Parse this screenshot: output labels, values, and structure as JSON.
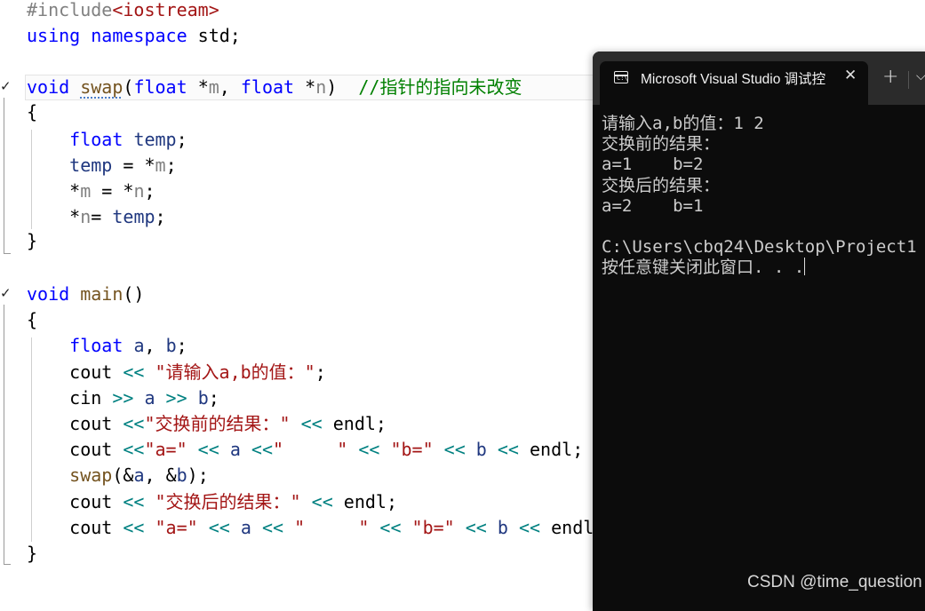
{
  "editor": {
    "lines": [
      {
        "id": "l1",
        "tokens": [
          {
            "t": "#include",
            "c": "#808080"
          },
          {
            "t": "<iostream>",
            "c": "#a31515"
          }
        ]
      },
      {
        "id": "l2",
        "tokens": [
          {
            "t": "using",
            "c": "#0000ff"
          },
          {
            "t": " ",
            "c": "#000"
          },
          {
            "t": "namespace",
            "c": "#0000ff"
          },
          {
            "t": " std;",
            "c": "#000000"
          }
        ]
      },
      {
        "id": "l3",
        "tokens": [
          {
            "t": "void",
            "c": "#0000ff"
          },
          {
            "t": " ",
            "c": "#000"
          },
          {
            "t": "swap",
            "c": "#74531f",
            "u": true
          },
          {
            "t": "(",
            "c": "#000"
          },
          {
            "t": "float",
            "c": "#0000ff"
          },
          {
            "t": " *",
            "c": "#000"
          },
          {
            "t": "m",
            "c": "#808080"
          },
          {
            "t": ", ",
            "c": "#000"
          },
          {
            "t": "float",
            "c": "#0000ff"
          },
          {
            "t": " *",
            "c": "#000"
          },
          {
            "t": "n",
            "c": "#808080"
          },
          {
            "t": ")  ",
            "c": "#000"
          },
          {
            "t": "//指针的指向未改变",
            "c": "#008000"
          }
        ]
      },
      {
        "id": "l4",
        "tokens": [
          {
            "t": "{",
            "c": "#000"
          }
        ]
      },
      {
        "id": "l5",
        "tokens": [
          {
            "t": "    ",
            "c": "#000"
          },
          {
            "t": "float",
            "c": "#0000ff"
          },
          {
            "t": " ",
            "c": "#000"
          },
          {
            "t": "temp",
            "c": "#1f377f"
          },
          {
            "t": ";",
            "c": "#000"
          }
        ]
      },
      {
        "id": "l6",
        "tokens": [
          {
            "t": "    ",
            "c": "#000"
          },
          {
            "t": "temp",
            "c": "#1f377f"
          },
          {
            "t": " = *",
            "c": "#000"
          },
          {
            "t": "m",
            "c": "#808080"
          },
          {
            "t": ";",
            "c": "#000"
          }
        ]
      },
      {
        "id": "l7",
        "tokens": [
          {
            "t": "    *",
            "c": "#000"
          },
          {
            "t": "m",
            "c": "#808080"
          },
          {
            "t": " = *",
            "c": "#000"
          },
          {
            "t": "n",
            "c": "#808080"
          },
          {
            "t": ";",
            "c": "#000"
          }
        ]
      },
      {
        "id": "l8",
        "tokens": [
          {
            "t": "    *",
            "c": "#000"
          },
          {
            "t": "n",
            "c": "#808080"
          },
          {
            "t": "= ",
            "c": "#000"
          },
          {
            "t": "temp",
            "c": "#1f377f"
          },
          {
            "t": ";",
            "c": "#000"
          }
        ]
      },
      {
        "id": "l9",
        "tokens": [
          {
            "t": "}",
            "c": "#000"
          }
        ]
      },
      {
        "id": "l10",
        "tokens": []
      },
      {
        "id": "l11",
        "tokens": [
          {
            "t": "void",
            "c": "#0000ff"
          },
          {
            "t": " ",
            "c": "#000"
          },
          {
            "t": "main",
            "c": "#74531f"
          },
          {
            "t": "()",
            "c": "#000"
          }
        ]
      },
      {
        "id": "l12",
        "tokens": [
          {
            "t": "{",
            "c": "#000"
          }
        ]
      },
      {
        "id": "l13",
        "tokens": [
          {
            "t": "    ",
            "c": "#000"
          },
          {
            "t": "float",
            "c": "#0000ff"
          },
          {
            "t": " ",
            "c": "#000"
          },
          {
            "t": "a",
            "c": "#1f377f"
          },
          {
            "t": ", ",
            "c": "#000"
          },
          {
            "t": "b",
            "c": "#1f377f"
          },
          {
            "t": ";",
            "c": "#000"
          }
        ]
      },
      {
        "id": "l14",
        "tokens": [
          {
            "t": "    ",
            "c": "#000"
          },
          {
            "t": "cout",
            "c": "#000"
          },
          {
            "t": " << ",
            "c": "#008080"
          },
          {
            "t": "\"请输入a,b的值：\"",
            "c": "#a31515"
          },
          {
            "t": ";",
            "c": "#000"
          }
        ]
      },
      {
        "id": "l15",
        "tokens": [
          {
            "t": "    ",
            "c": "#000"
          },
          {
            "t": "cin",
            "c": "#000"
          },
          {
            "t": " >> ",
            "c": "#008080"
          },
          {
            "t": "a",
            "c": "#1f377f"
          },
          {
            "t": " >> ",
            "c": "#008080"
          },
          {
            "t": "b",
            "c": "#1f377f"
          },
          {
            "t": ";",
            "c": "#000"
          }
        ]
      },
      {
        "id": "l16",
        "tokens": [
          {
            "t": "    ",
            "c": "#000"
          },
          {
            "t": "cout",
            "c": "#000"
          },
          {
            "t": " <<",
            "c": "#008080"
          },
          {
            "t": "\"交换前的结果：\"",
            "c": "#a31515"
          },
          {
            "t": " << ",
            "c": "#008080"
          },
          {
            "t": "endl",
            "c": "#000"
          },
          {
            "t": ";",
            "c": "#000"
          }
        ]
      },
      {
        "id": "l17",
        "tokens": [
          {
            "t": "    ",
            "c": "#000"
          },
          {
            "t": "cout",
            "c": "#000"
          },
          {
            "t": " <<",
            "c": "#008080"
          },
          {
            "t": "\"a=\"",
            "c": "#a31515"
          },
          {
            "t": " << ",
            "c": "#008080"
          },
          {
            "t": "a",
            "c": "#1f377f"
          },
          {
            "t": " <<",
            "c": "#008080"
          },
          {
            "t": "\"     \"",
            "c": "#a31515"
          },
          {
            "t": " << ",
            "c": "#008080"
          },
          {
            "t": "\"b=\"",
            "c": "#a31515"
          },
          {
            "t": " << ",
            "c": "#008080"
          },
          {
            "t": "b",
            "c": "#1f377f"
          },
          {
            "t": " << ",
            "c": "#008080"
          },
          {
            "t": "endl",
            "c": "#000"
          },
          {
            "t": ";",
            "c": "#000"
          }
        ]
      },
      {
        "id": "l18",
        "tokens": [
          {
            "t": "    ",
            "c": "#000"
          },
          {
            "t": "swap",
            "c": "#74531f"
          },
          {
            "t": "(&",
            "c": "#000"
          },
          {
            "t": "a",
            "c": "#1f377f"
          },
          {
            "t": ", &",
            "c": "#000"
          },
          {
            "t": "b",
            "c": "#1f377f"
          },
          {
            "t": ");",
            "c": "#000"
          }
        ]
      },
      {
        "id": "l19",
        "tokens": [
          {
            "t": "    ",
            "c": "#000"
          },
          {
            "t": "cout",
            "c": "#000"
          },
          {
            "t": " << ",
            "c": "#008080"
          },
          {
            "t": "\"交换后的结果：\"",
            "c": "#a31515"
          },
          {
            "t": " << ",
            "c": "#008080"
          },
          {
            "t": "endl",
            "c": "#000"
          },
          {
            "t": ";",
            "c": "#000"
          }
        ]
      },
      {
        "id": "l20",
        "tokens": [
          {
            "t": "    ",
            "c": "#000"
          },
          {
            "t": "cout",
            "c": "#000"
          },
          {
            "t": " << ",
            "c": "#008080"
          },
          {
            "t": "\"a=\"",
            "c": "#a31515"
          },
          {
            "t": " << ",
            "c": "#008080"
          },
          {
            "t": "a",
            "c": "#1f377f"
          },
          {
            "t": " << ",
            "c": "#008080"
          },
          {
            "t": "\"     \"",
            "c": "#a31515"
          },
          {
            "t": " << ",
            "c": "#008080"
          },
          {
            "t": "\"b=\"",
            "c": "#a31515"
          },
          {
            "t": " << ",
            "c": "#008080"
          },
          {
            "t": "b",
            "c": "#1f377f"
          },
          {
            "t": " << ",
            "c": "#008080"
          },
          {
            "t": "endl",
            "c": "#000"
          },
          {
            "t": ";",
            "c": "#000"
          }
        ]
      },
      {
        "id": "l21",
        "tokens": [
          {
            "t": "}",
            "c": "#000"
          }
        ]
      }
    ]
  },
  "console": {
    "icon_glyph": "C:\\",
    "tab_title": "Microsoft Visual Studio 调试控",
    "close_glyph": "✕",
    "new_tab_glyph": "+",
    "dropdown_glyph": "⌵",
    "lines": [
      "请输入a,b的值：1 2",
      "交换前的结果：",
      "a=1    b=2",
      "交换后的结果：",
      "a=2    b=1",
      "",
      "C:\\Users\\cbq24\\Desktop\\Project1",
      "按任意键关闭此窗口. . ."
    ]
  },
  "watermark": "CSDN @time_question",
  "colors": {
    "keyword": "#0000ff",
    "string": "#a31515",
    "comment": "#008000",
    "function": "#74531f",
    "variable": "#1f377f",
    "operator": "#008080",
    "console_bg": "#0c0c0c",
    "console_text": "#cccccc"
  }
}
